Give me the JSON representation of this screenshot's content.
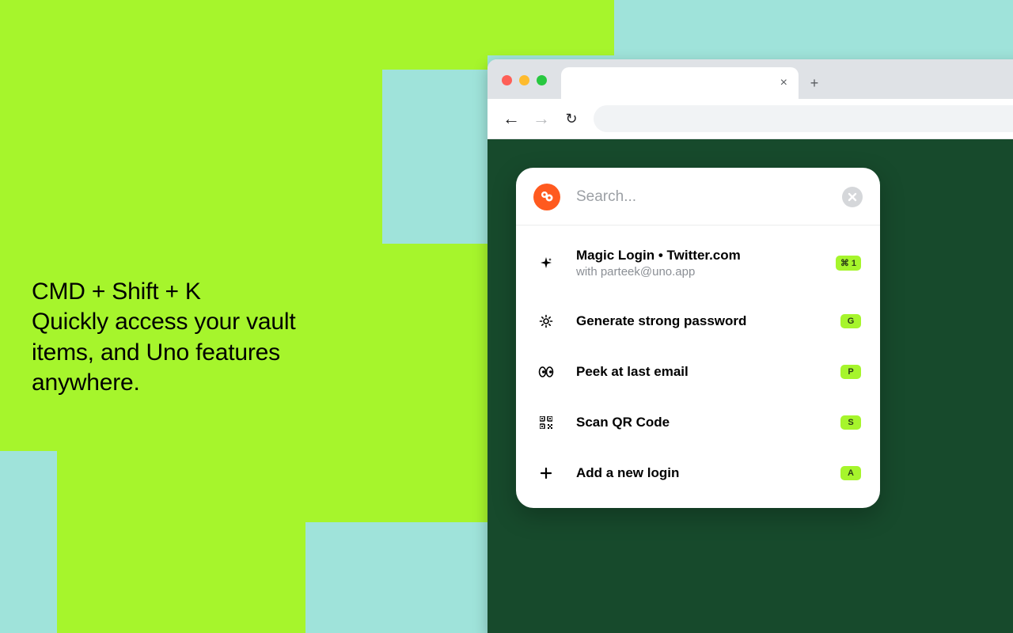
{
  "promo": {
    "headline": "CMD + Shift + K",
    "body": "Quickly access your vault items, and Uno features anywhere."
  },
  "palette": {
    "search_placeholder": "Search...",
    "items": [
      {
        "icon": "sparkle",
        "title": "Magic Login • Twitter.com",
        "subtitle": "with parteek@uno.app",
        "shortcut": "⌘ 1"
      },
      {
        "icon": "gear-sun",
        "title": "Generate strong password",
        "subtitle": "",
        "shortcut": "G"
      },
      {
        "icon": "eyes",
        "title": "Peek at last email",
        "subtitle": "",
        "shortcut": "P"
      },
      {
        "icon": "qr",
        "title": "Scan QR Code",
        "subtitle": "",
        "shortcut": "S"
      },
      {
        "icon": "plus",
        "title": "Add a new login",
        "subtitle": "",
        "shortcut": "A"
      }
    ]
  },
  "colors": {
    "lime": "#A6F52C",
    "teal": "#9FE3DA",
    "viewport": "#174A2C",
    "logo": "#FF5A1F"
  }
}
